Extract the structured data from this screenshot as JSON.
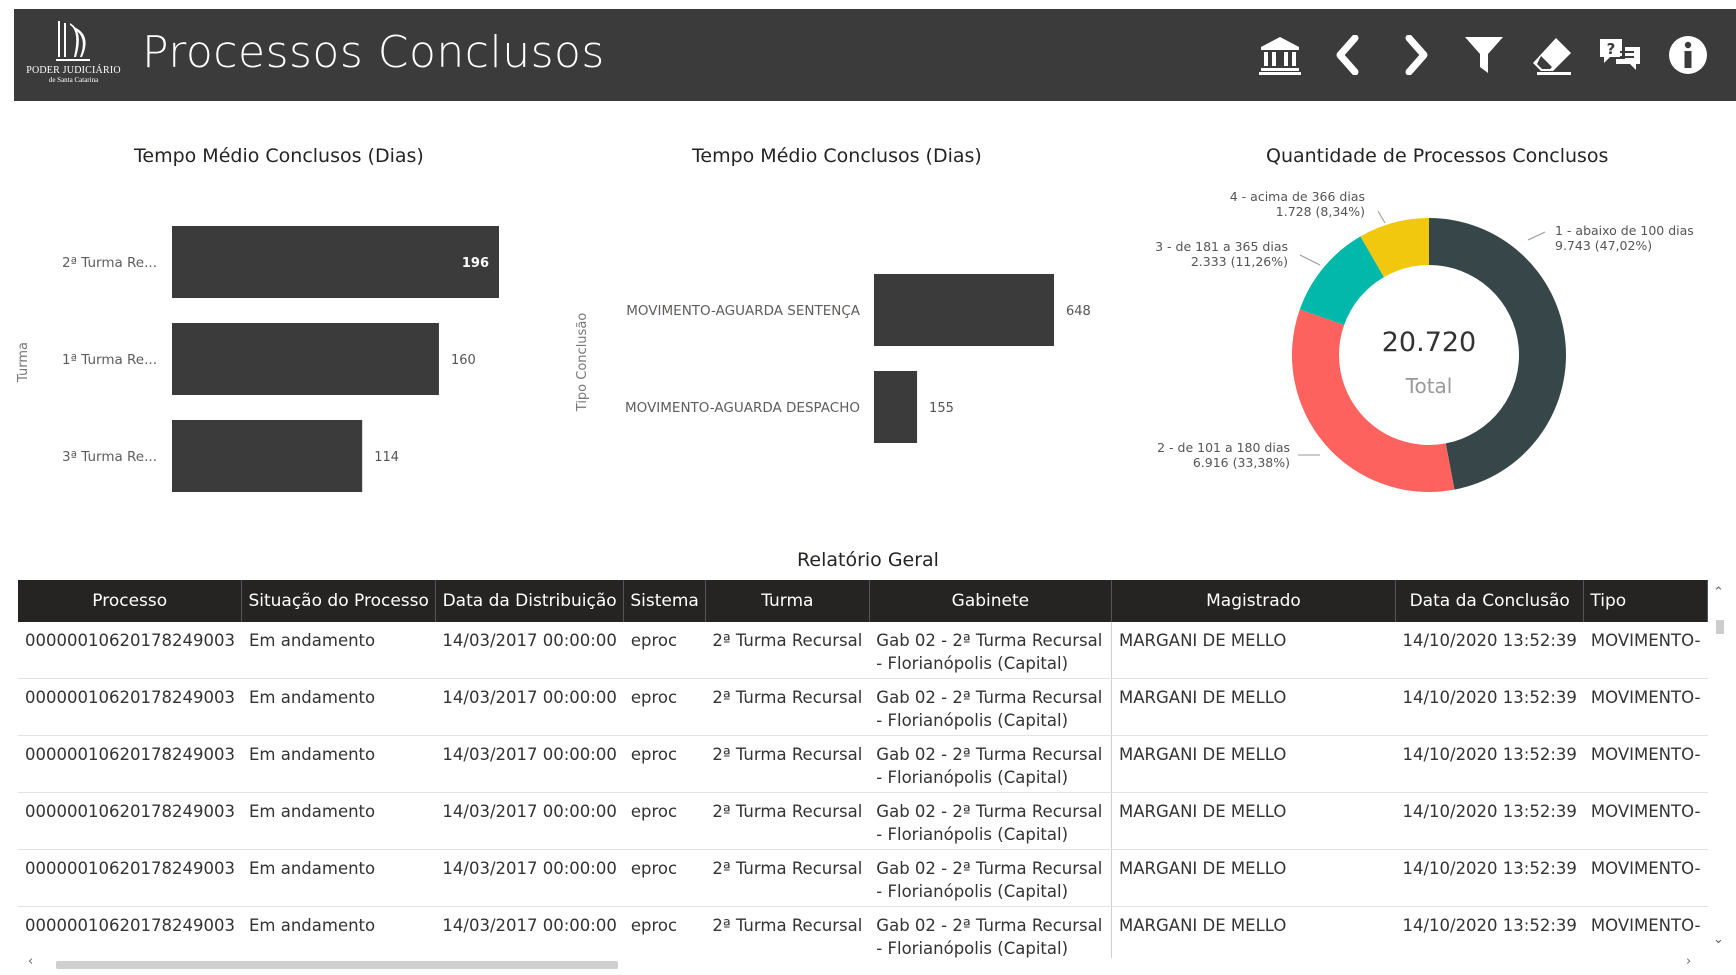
{
  "header": {
    "title": "Processos Conclusos",
    "logo_line1": "PODER JUDICIÁRIO",
    "logo_line2": "de Santa Catarina",
    "icons": [
      "bank-icon",
      "back-icon",
      "forward-icon",
      "filter-icon",
      "eraser-icon",
      "help-chat-icon",
      "info-icon"
    ]
  },
  "chart_data": [
    {
      "type": "bar",
      "title": "Tempo Médio Conclusos (Dias)",
      "ylabel": "Turma",
      "categories": [
        "2ª Turma Re...",
        "1ª Turma Re...",
        "3ª Turma Re..."
      ],
      "values": [
        196,
        160,
        114
      ],
      "xlim": [
        0,
        196
      ],
      "color": "#3b3b3b"
    },
    {
      "type": "bar",
      "title": "Tempo Médio Conclusos (Dias)",
      "ylabel": "Tipo Conclusão",
      "categories": [
        "MOVIMENTO-AGUARDA SENTENÇA",
        "MOVIMENTO-AGUARDA DESPACHO"
      ],
      "values": [
        648,
        155
      ],
      "xlim": [
        0,
        648
      ],
      "color": "#3b3b3b"
    },
    {
      "type": "pie",
      "title": "Quantidade de Processos Conclusos",
      "center_value": "20.720",
      "center_label": "Total",
      "slices": [
        {
          "label": "1 - abaixo de 100 dias",
          "value_label": "9.743 (47,02%)",
          "value": 9743,
          "color": "#374649"
        },
        {
          "label": "2 - de 101 a 180 dias",
          "value_label": "6.916 (33,38%)",
          "value": 6916,
          "color": "#FD625E"
        },
        {
          "label": "3 - de 181 a 365 dias",
          "value_label": "2.333 (11,26%)",
          "value": 2333,
          "color": "#01B8AA"
        },
        {
          "label": "4 - acima de 366 dias",
          "value_label": "1.728 (8,34%)",
          "value": 1728,
          "color": "#F2C80F"
        }
      ]
    }
  ],
  "report": {
    "title": "Relatório Geral",
    "columns": [
      "Processo",
      "Situação do Processo",
      "Data da Distribuição",
      "Sistema",
      "Turma",
      "Gabinete",
      "Magistrado",
      "Data da Conclusão",
      "Tipo"
    ],
    "rows": [
      [
        "00000010620178249003",
        "Em andamento",
        "14/03/2017 00:00:00",
        "eproc",
        "2ª Turma Recursal",
        "Gab 02 - 2ª Turma Recursal - Florianópolis (Capital)",
        "MARGANI DE MELLO",
        "14/10/2020 13:52:39",
        "MOVIMENTO-"
      ],
      [
        "00000010620178249003",
        "Em andamento",
        "14/03/2017 00:00:00",
        "eproc",
        "2ª Turma Recursal",
        "Gab 02 - 2ª Turma Recursal - Florianópolis (Capital)",
        "MARGANI DE MELLO",
        "14/10/2020 13:52:39",
        "MOVIMENTO-"
      ],
      [
        "00000010620178249003",
        "Em andamento",
        "14/03/2017 00:00:00",
        "eproc",
        "2ª Turma Recursal",
        "Gab 02 - 2ª Turma Recursal - Florianópolis (Capital)",
        "MARGANI DE MELLO",
        "14/10/2020 13:52:39",
        "MOVIMENTO-"
      ],
      [
        "00000010620178249003",
        "Em andamento",
        "14/03/2017 00:00:00",
        "eproc",
        "2ª Turma Recursal",
        "Gab 02 - 2ª Turma Recursal - Florianópolis (Capital)",
        "MARGANI DE MELLO",
        "14/10/2020 13:52:39",
        "MOVIMENTO-"
      ],
      [
        "00000010620178249003",
        "Em andamento",
        "14/03/2017 00:00:00",
        "eproc",
        "2ª Turma Recursal",
        "Gab 02 - 2ª Turma Recursal - Florianópolis (Capital)",
        "MARGANI DE MELLO",
        "14/10/2020 13:52:39",
        "MOVIMENTO-"
      ],
      [
        "00000010620178249003",
        "Em andamento",
        "14/03/2017 00:00:00",
        "eproc",
        "2ª Turma Recursal",
        "Gab 02 - 2ª Turma Recursal - Florianópolis (Capital)",
        "MARGANI DE MELLO",
        "14/10/2020 13:52:39",
        "MOVIMENTO-"
      ]
    ]
  }
}
